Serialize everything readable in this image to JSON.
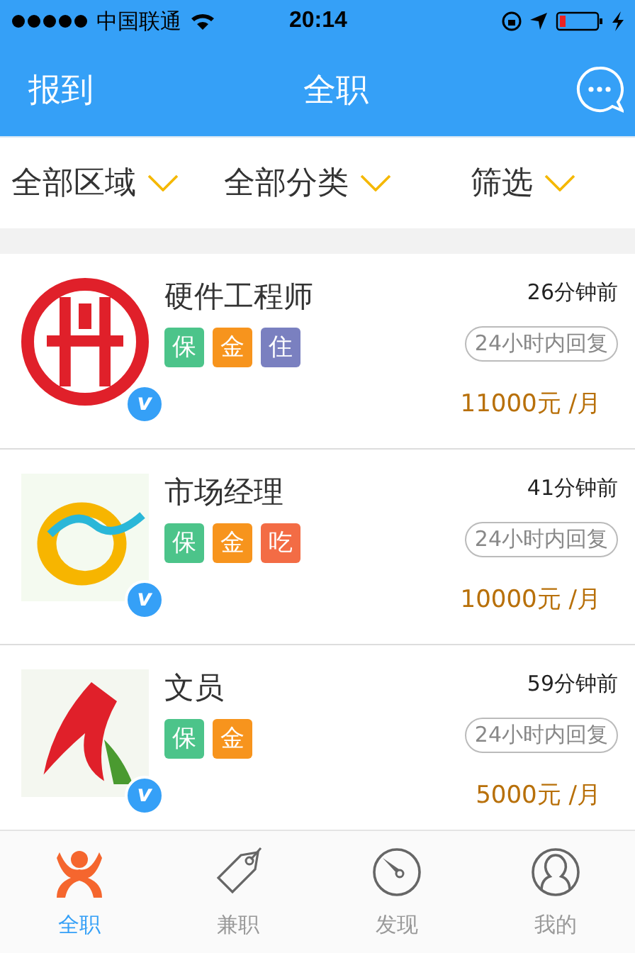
{
  "status_bar": {
    "carrier": "中国联通",
    "time": "20:14"
  },
  "nav_bar": {
    "left": "报到",
    "title": "全职"
  },
  "filters": [
    {
      "label": "全部区域"
    },
    {
      "label": "全部分类"
    },
    {
      "label": "筛选"
    }
  ],
  "jobs": [
    {
      "title": "硬件工程师",
      "time": "26分钟前",
      "reply": "24小时内回复",
      "salary": "11000元 /月",
      "verified": "v",
      "tags": [
        {
          "label": "保",
          "color": "#4cc48a"
        },
        {
          "label": "金",
          "color": "#f7941d"
        },
        {
          "label": "住",
          "color": "#7a80c0"
        }
      ]
    },
    {
      "title": "市场经理",
      "time": "41分钟前",
      "reply": "24小时内回复",
      "salary": "10000元 /月",
      "verified": "v",
      "tags": [
        {
          "label": "保",
          "color": "#4cc48a"
        },
        {
          "label": "金",
          "color": "#f7941d"
        },
        {
          "label": "吃",
          "color": "#f36c45"
        }
      ]
    },
    {
      "title": "文员",
      "time": "59分钟前",
      "reply": "24小时内回复",
      "salary": "5000元 /月",
      "verified": "v",
      "tags": [
        {
          "label": "保",
          "color": "#4cc48a"
        },
        {
          "label": "金",
          "color": "#f7941d"
        }
      ]
    }
  ],
  "tab_bar": [
    {
      "label": "全职",
      "selected": true
    },
    {
      "label": "兼职",
      "selected": false
    },
    {
      "label": "发现",
      "selected": false
    },
    {
      "label": "我的",
      "selected": false
    }
  ]
}
